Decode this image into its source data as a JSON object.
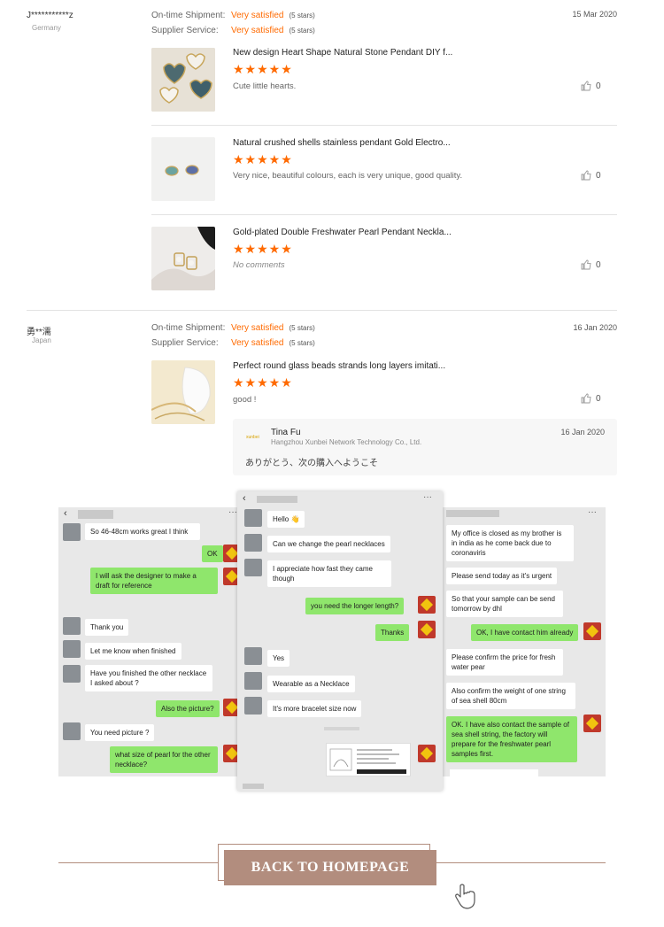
{
  "labels": {
    "on_time": "On-time Shipment:",
    "supplier_service": "Supplier Service:"
  },
  "reviews": [
    {
      "buyer": "J***********z",
      "country": "Germany",
      "on_time_value": "Very satisfied",
      "on_time_stars": "(5 stars)",
      "service_value": "Very satisfied",
      "service_stars": "(5 stars)",
      "date": "15 Mar 2020",
      "items": [
        {
          "title": "New design Heart Shape Natural Stone Pendant DIY f...",
          "stars": "★★★★★",
          "comment": "Cute little hearts.",
          "likes": "0"
        },
        {
          "title": "Natural crushed shells stainless pendant Gold Electro...",
          "stars": "★★★★★",
          "comment": "Very nice, beautiful colours, each is very unique, good quality.",
          "likes": "0"
        },
        {
          "title": "Gold-plated Double Freshwater Pearl Pendant Neckla...",
          "stars": "★★★★★",
          "comment": "No comments",
          "likes": "0"
        }
      ]
    },
    {
      "buyer": "勇**濡",
      "country": "Japan",
      "on_time_value": "Very satisfied",
      "on_time_stars": "(5 stars)",
      "service_value": "Very satisfied",
      "service_stars": "(5 stars)",
      "date": "16 Jan 2020",
      "items": [
        {
          "title": "Perfect round glass beads strands long layers imitati...",
          "stars": "★★★★★",
          "comment": "good !",
          "likes": "0"
        }
      ],
      "reply": {
        "name": "Tina Fu",
        "company": "Hangzhou Xunbei Network Technology Co., Ltd.",
        "date": "16 Jan 2020",
        "text": "ありがとう、次の購入へようこそ"
      }
    }
  ],
  "chat_left": {
    "messages": [
      "So 46-48cm works great I think",
      "OK",
      "I will ask the designer to make a draft for reference",
      "Thank you",
      "Let me know when finished",
      "Have you finished the other necklace I asked about ?",
      "Also the picture?",
      "You need picture ?",
      "what size of pearl for the other necklace?"
    ]
  },
  "chat_middle": {
    "messages": [
      "Hello 👋",
      "Can we change the pearl necklaces",
      "I appreciate how fast they came though",
      "you need the longer length?",
      "Thanks",
      "Yes",
      "Wearable as a Necklace",
      "It's more bracelet size now"
    ]
  },
  "chat_right": {
    "messages": [
      "My office is closed as my brother is in india as he come back due to coronaviris",
      "Please send today as it's urgent",
      "So that your sample can be send tomorrow by dhl",
      "OK, I have contact him already",
      "Please confirm the price for fresh water pear",
      "Also confirm the weight of one string of sea shell 80cm",
      "OK. I have also contact the sample of sea shell string, the factory will prepare for the freshwater pearl samples first."
    ]
  },
  "footer": {
    "back_label": "BACK TO HOMEPAGE"
  },
  "colors": {
    "accent": "#ff6a00",
    "button": "#b28d7e",
    "chat_out": "#8fe66c"
  }
}
